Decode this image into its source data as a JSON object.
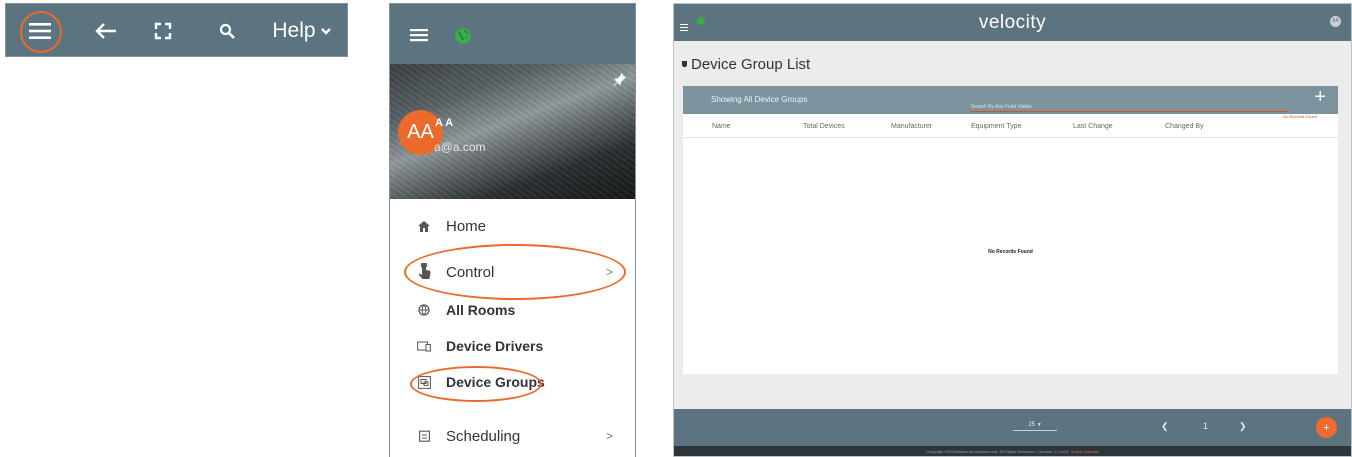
{
  "toolbar": {
    "help_label": "Help"
  },
  "side_menu": {
    "user_initials": "AA",
    "user_name": "A A",
    "user_email": "a@a.com",
    "items": [
      {
        "label": "Home",
        "icon": "home-icon"
      },
      {
        "label": "Control",
        "icon": "touch-hand-icon",
        "chevron": ">"
      },
      {
        "label": "All Rooms",
        "icon": "globe-icon"
      },
      {
        "label": "Device Drivers",
        "icon": "devices-icon"
      },
      {
        "label": "Device Groups",
        "icon": "device-groups-icon"
      },
      {
        "label": "Scheduling",
        "icon": "calendar-icon",
        "chevron": ">"
      }
    ]
  },
  "app": {
    "logo": "velocity",
    "user_badge": "AA",
    "page_title": "Device Group List",
    "card": {
      "showing": "Showing All Device Groups",
      "search_placeholder": "Search By Any Field Visible",
      "no_records_small": "No Records Found",
      "columns": [
        "Name",
        "Total Devices",
        "Manufacturer",
        "Equipment Type",
        "Last Change",
        "Changed By"
      ],
      "empty_message": "No Records Found"
    },
    "footer": {
      "page_size": "25",
      "page_number": "1",
      "fab_label": "+"
    },
    "copyright": "Copyright ©2022Atlona Inc (atlona.com). All Rights Reserved. | Version: 2.1.rc22",
    "gateway": "Active Gateway"
  },
  "colors": {
    "header": "#5c7480",
    "accent_orange": "#ea6b2c",
    "status_green": "#3cab4b"
  }
}
